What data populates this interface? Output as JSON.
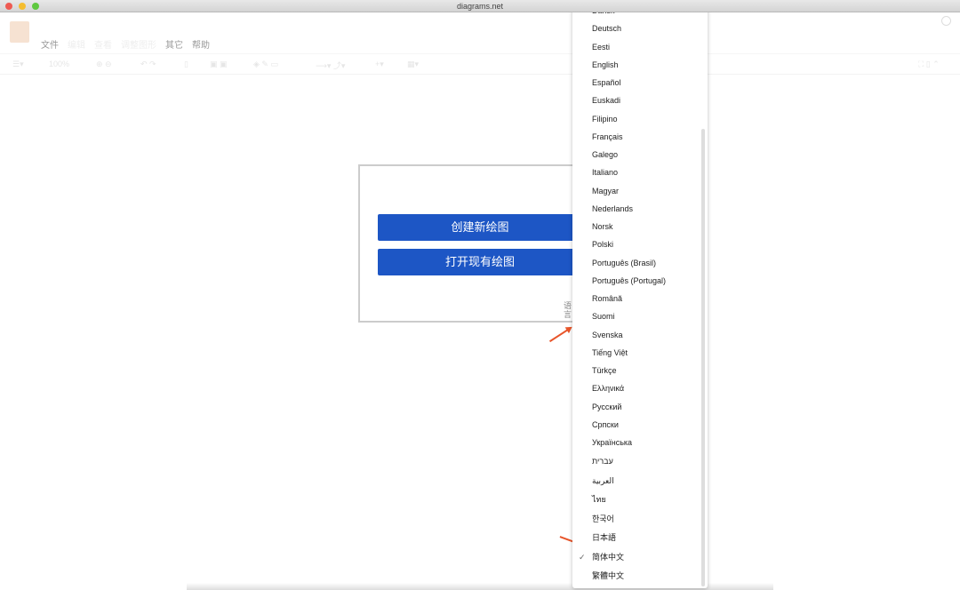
{
  "window": {
    "title": "diagrams.net"
  },
  "menubar": [
    {
      "label": "文件",
      "enabled": true
    },
    {
      "label": "编辑",
      "enabled": false
    },
    {
      "label": "查看",
      "enabled": false
    },
    {
      "label": "调整图形",
      "enabled": false
    },
    {
      "label": "其它",
      "enabled": true
    },
    {
      "label": "帮助",
      "enabled": true
    }
  ],
  "toolbar": {
    "zoom": "100%"
  },
  "dialog": {
    "create_label": "创建新绘图",
    "open_label": "打开现有绘图",
    "language_label": "语言"
  },
  "language_menu": {
    "selected": "简体中文",
    "items": [
      "Dansk",
      "Deutsch",
      "Eesti",
      "English",
      "Español",
      "Euskadi",
      "Filipino",
      "Français",
      "Galego",
      "Italiano",
      "Magyar",
      "Nederlands",
      "Norsk",
      "Polski",
      "Português (Brasil)",
      "Português (Portugal)",
      "Română",
      "Suomi",
      "Svenska",
      "Tiếng Việt",
      "Türkçe",
      "Ελληνικά",
      "Русский",
      "Српски",
      "Українська",
      "עברית",
      "العربية",
      "ไทย",
      "한국어",
      "日本語",
      "简体中文",
      "繁體中文"
    ]
  },
  "colors": {
    "accent": "#1d56c5",
    "annotation_arrow": "#e8552a"
  }
}
